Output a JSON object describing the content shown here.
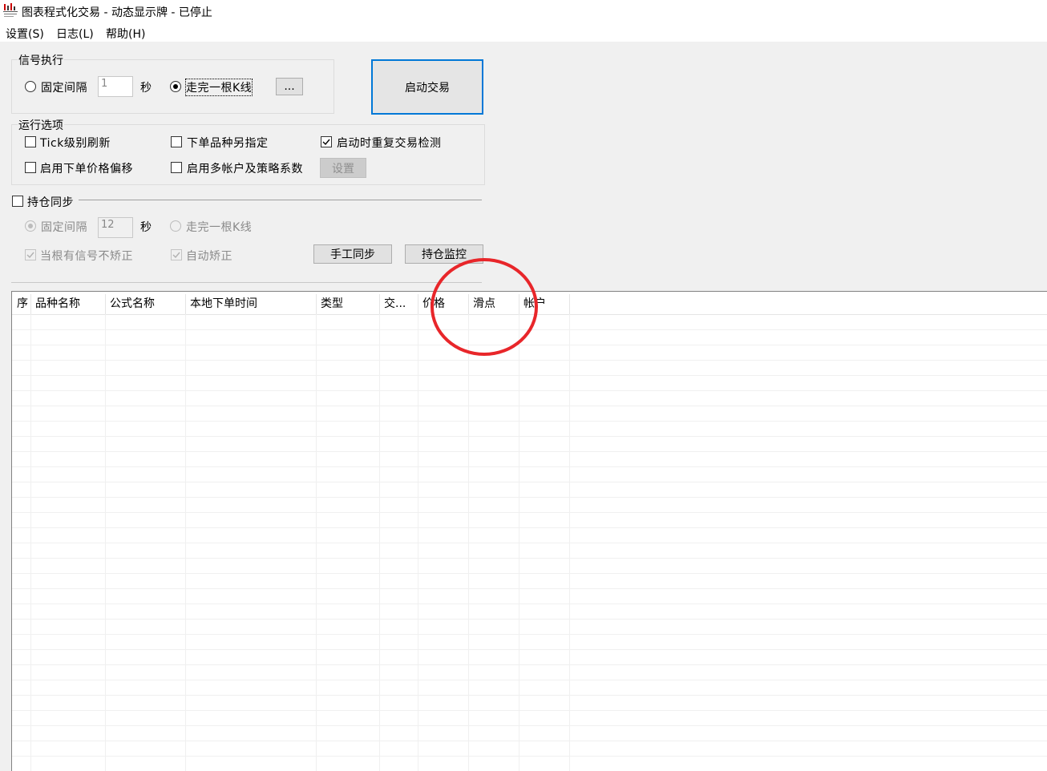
{
  "window": {
    "title": "图表程式化交易 - 动态显示牌 - 已停止",
    "icon": "chart-trading-app-icon"
  },
  "menu": {
    "settings": "设置(S)",
    "log": "日志(L)",
    "help": "帮助(H)"
  },
  "signal_exec": {
    "legend": "信号执行",
    "fixed_interval_label": "固定间隔",
    "interval_value": "1",
    "seconds_label": "秒",
    "kline_label": "走完一根K线",
    "ellipsis_button": "...",
    "fixed_interval_checked": false,
    "kline_checked": true
  },
  "start_button": "启动交易",
  "run_options": {
    "legend": "运行选项",
    "tick_refresh": "Tick级别刷新",
    "order_symbol": "下单品种另指定",
    "repeat_check": "启动时重复交易检测",
    "price_offset": "启用下单价格偏移",
    "multi_account": "启用多帐户及策略系数",
    "setup_button": "设置",
    "repeat_check_checked": true
  },
  "position_sync": {
    "label": "持仓同步",
    "fixed_interval_label": "固定间隔",
    "interval_value": "12",
    "seconds_label": "秒",
    "kline_label": "走完一根K线",
    "no_signal_fix": "当根有信号不矫正",
    "auto_fix": "自动矫正",
    "manual_sync_button": "手工同步",
    "monitor_button": "持仓监控"
  },
  "grid": {
    "columns": [
      "序",
      "品种名称",
      "公式名称",
      "本地下单时间",
      "类型",
      "交...",
      "价格",
      "滑点",
      "帐户"
    ],
    "rows": []
  },
  "colors": {
    "accent": "#0078d7",
    "annotation": "#e8262a",
    "background": "#f0f0f0"
  }
}
